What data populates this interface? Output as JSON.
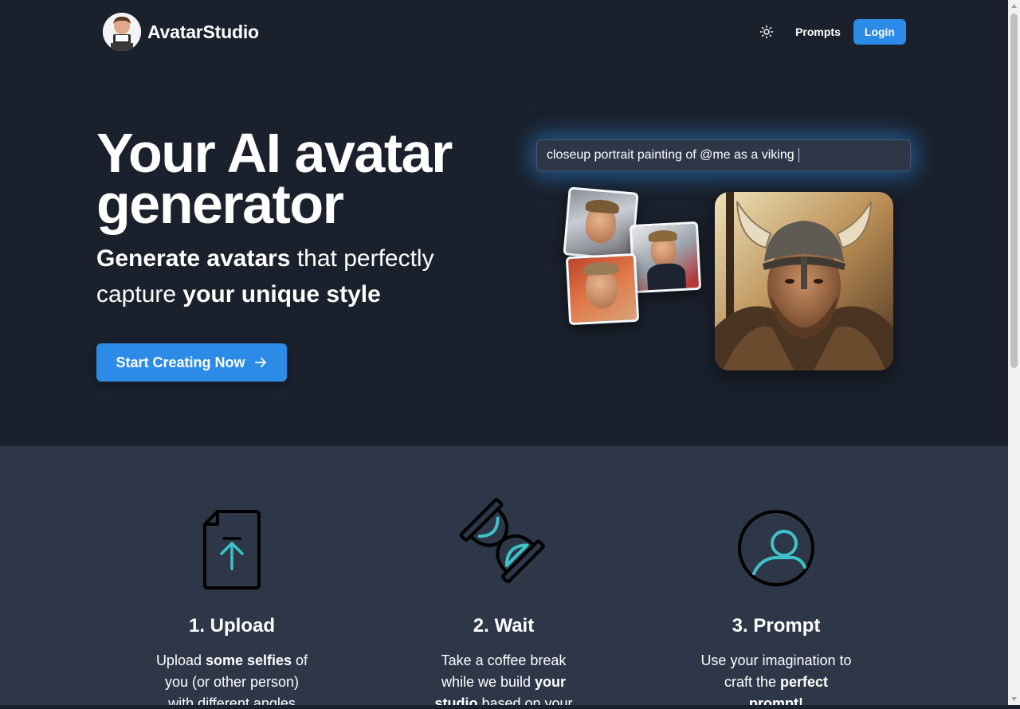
{
  "header": {
    "brand": "AvatarStudio",
    "nav": {
      "prompts": "Prompts",
      "login": "Login"
    }
  },
  "hero": {
    "title": "Your AI avatar generator",
    "subtitle": {
      "part1": "Generate avatars",
      "part2": " that perfectly capture ",
      "part3": "your unique style"
    },
    "cta": "Start Creating Now",
    "prompt": "closeup portrait painting of @me as a viking"
  },
  "steps": [
    {
      "title": "1. Upload",
      "t1": "Upload ",
      "b1": "some selfies",
      "t2": " of you (or other person) with different angles"
    },
    {
      "title": "2. Wait",
      "t1": "Take a coffee break while we build ",
      "b1": "your studio",
      "t2": " based on your"
    },
    {
      "title": "3. Prompt",
      "t1": "Use your imagination to craft the ",
      "b1": "perfect prompt!",
      "t2": ""
    }
  ],
  "colors": {
    "bg": "#1a202c",
    "section": "#2d3748",
    "accent": "#2b8be6",
    "icon_teal": "#3ec1c9"
  }
}
